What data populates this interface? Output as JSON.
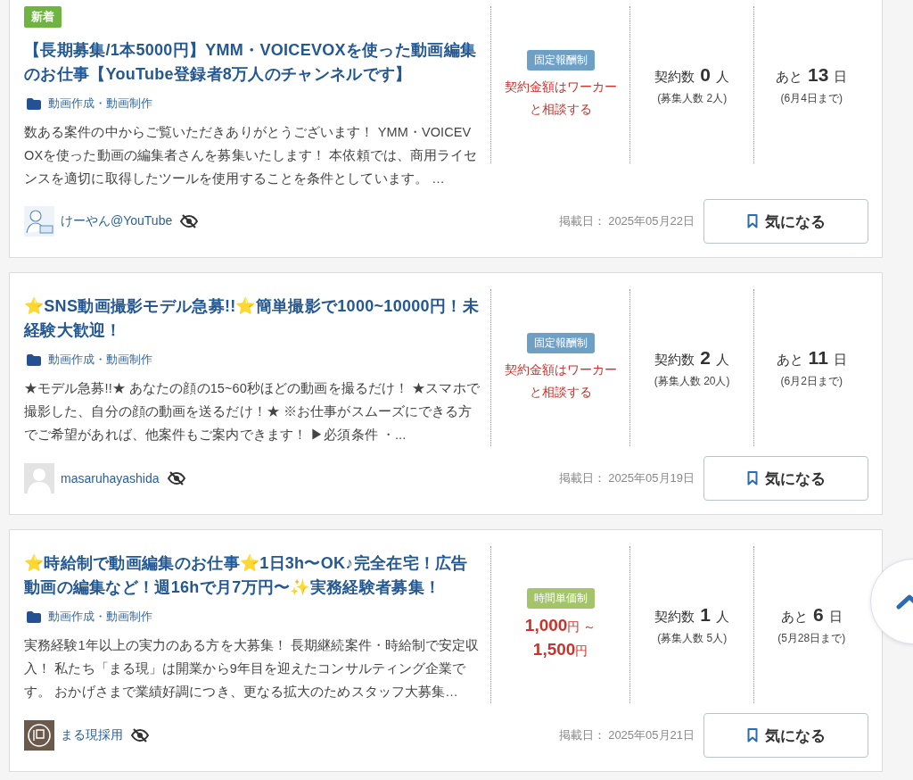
{
  "jobs": [
    {
      "new_badge": "新着",
      "title": "【長期募集/1本5000円】YMM・VOICEVOXを使った動画編集のお仕事【YouTube登録者8万人のチャンネルです】",
      "category": "動画作成・動画制作",
      "description": "数ある案件の中からご覧いただきありがとうございます！ YMM・VOICEVOXを使った動画の編集者さんを募集いたします！ 本依頼では、商用ライセンスを適切に取得したツールを使用することを条件としています。 …",
      "pay_type": {
        "label": "固定報酬制",
        "color": "#6e9fc4"
      },
      "price": {
        "kind": "text",
        "text": "契約金額はワーカーと相談する"
      },
      "contracts": {
        "label": "契約数",
        "count": "0",
        "unit": "人",
        "note": "(募集人数 2人)"
      },
      "deadline": {
        "label": "あと",
        "days": "13",
        "unit": "日",
        "note": "(6月4日まで)"
      },
      "client": {
        "kind": "illustration",
        "name": "けーやん@YouTube"
      },
      "posted": "掲載日： 2025年05月22日",
      "bookmark": "気になる"
    },
    {
      "title": "⭐SNS動画撮影モデル急募!!⭐簡単撮影で1000~10000円！未経験大歓迎！",
      "category": "動画作成・動画制作",
      "description": "★モデル急募!!★ あなたの顔の15~60秒ほどの動画を撮るだけ！ ★スマホで撮影した、自分の顔の動画を送るだけ！★ ※お仕事がスムーズにできる方でご希望があれば、他案件もご案内できます！ ▶必須条件 ・...",
      "pay_type": {
        "label": "固定報酬制",
        "color": "#6e9fc4"
      },
      "price": {
        "kind": "text",
        "text": "契約金額はワーカーと相談する"
      },
      "contracts": {
        "label": "契約数",
        "count": "2",
        "unit": "人",
        "note": "(募集人数 20人)"
      },
      "deadline": {
        "label": "あと",
        "days": "11",
        "unit": "日",
        "note": "(6月2日まで)"
      },
      "client": {
        "kind": "default",
        "name": "masaruhayashida"
      },
      "posted": "掲載日： 2025年05月19日",
      "bookmark": "気になる"
    },
    {
      "title": "⭐時給制で動画編集のお仕事⭐1日3h〜OK♪完全在宅！広告動画の編集など！週16hで月7万円〜✨実務経験者募集！",
      "category": "動画作成・動画制作",
      "description": "実務経験1年以上の実力のある方を大募集！ 長期継続案件・時給制で安定収入！ 私たち「まる現」は開業から9年目を迎えたコンサルティング企業です。 おかげさまで業績好調につき、更なる拡大のためスタッフ大募集…",
      "pay_type": {
        "label": "時間単価制",
        "color": "#a4c46c"
      },
      "price": {
        "kind": "range",
        "from": "1,000",
        "from_unit": "円",
        "separator": "～",
        "to": "1,500",
        "to_unit": "円"
      },
      "contracts": {
        "label": "契約数",
        "count": "1",
        "unit": "人",
        "note": "(募集人数 5人)"
      },
      "deadline": {
        "label": "あと",
        "days": "6",
        "unit": "日",
        "note": "(5月28日まで)"
      },
      "client": {
        "kind": "logo",
        "name": "まる現採用"
      },
      "posted": "掲載日： 2025年05月21日",
      "bookmark": "気になる"
    }
  ]
}
